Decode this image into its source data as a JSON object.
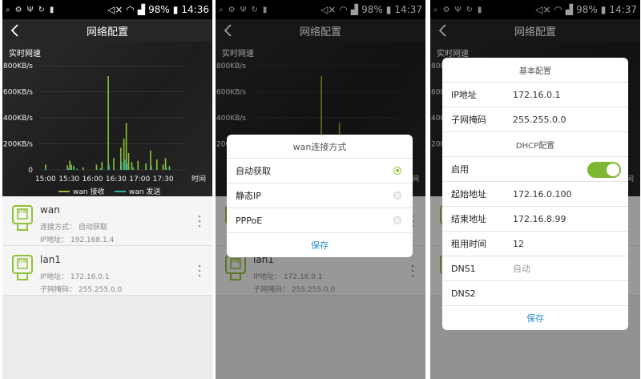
{
  "status_bar": {
    "battery": "98%",
    "times": [
      "14:36",
      "14:37",
      "14:37"
    ]
  },
  "app": {
    "title": "网络配置"
  },
  "chart_data": {
    "type": "bar",
    "title": "实时网速",
    "xlabel": "时间",
    "ylim": [
      0,
      800
    ],
    "y_ticks": [
      "0",
      "200KB/s",
      "400KB/s",
      "600KB/s",
      "800KB/s"
    ],
    "x_ticks": [
      "15:00",
      "15:30",
      "16:00",
      "16:30",
      "17:00",
      "17:30"
    ],
    "x_range": [
      "14:52",
      "17:58"
    ],
    "series": [
      {
        "name": "wan 接收",
        "color": "#8fc236",
        "points": [
          [
            "15:00",
            40
          ],
          [
            "15:28",
            35
          ],
          [
            "15:31",
            70
          ],
          [
            "15:33",
            40
          ],
          [
            "15:36",
            30
          ],
          [
            "15:48",
            20
          ],
          [
            "16:05",
            40
          ],
          [
            "16:12",
            60
          ],
          [
            "16:20",
            720
          ],
          [
            "16:27",
            90
          ],
          [
            "16:36",
            170
          ],
          [
            "16:40",
            240
          ],
          [
            "16:43",
            360
          ],
          [
            "16:46",
            130
          ],
          [
            "16:50",
            60
          ],
          [
            "16:58",
            70
          ],
          [
            "17:08",
            50
          ],
          [
            "17:14",
            150
          ],
          [
            "17:22",
            80
          ],
          [
            "17:30",
            40
          ],
          [
            "17:33",
            90
          ],
          [
            "17:38",
            30
          ]
        ]
      },
      {
        "name": "wan 发送",
        "color": "#2bb3a3",
        "points": [
          [
            "15:00",
            10
          ],
          [
            "15:29",
            12
          ],
          [
            "15:32",
            20
          ],
          [
            "15:40",
            10
          ],
          [
            "16:10",
            12
          ],
          [
            "16:21",
            40
          ],
          [
            "16:37",
            60
          ],
          [
            "16:41",
            80
          ],
          [
            "16:44",
            50
          ],
          [
            "16:52",
            20
          ],
          [
            "17:15",
            30
          ],
          [
            "17:34",
            20
          ]
        ]
      }
    ]
  },
  "list": [
    {
      "name": "wan",
      "line1": "连接方式：  自动获取",
      "line2": "IP地址：  192.168.1.4"
    },
    {
      "name": "lan1",
      "line1": "IP地址：  172.16.0.1",
      "line2": "子网掩码：  255.255.0.0"
    }
  ],
  "wan_dialog": {
    "title": "wan连接方式",
    "options": [
      {
        "label": "自动获取",
        "selected": true
      },
      {
        "label": "静态IP",
        "selected": false
      },
      {
        "label": "PPPoE",
        "selected": false
      }
    ],
    "save": "保存"
  },
  "lan_dialog": {
    "basic_title": "基本配置",
    "ip_label": "IP地址",
    "ip_value": "172.16.0.1",
    "mask_label": "子网掩码",
    "mask_value": "255.255.0.0",
    "dhcp_title": "DHCP配置",
    "enable_label": "启用",
    "enable_on": true,
    "start_label": "起始地址",
    "start_value": "172.16.0.100",
    "end_label": "结束地址",
    "end_value": "172.16.8.99",
    "lease_label": "租用时间",
    "lease_value": "12",
    "dns1_label": "DNS1",
    "dns1_placeholder": "自动",
    "dns2_label": "DNS2",
    "save": "保存"
  }
}
